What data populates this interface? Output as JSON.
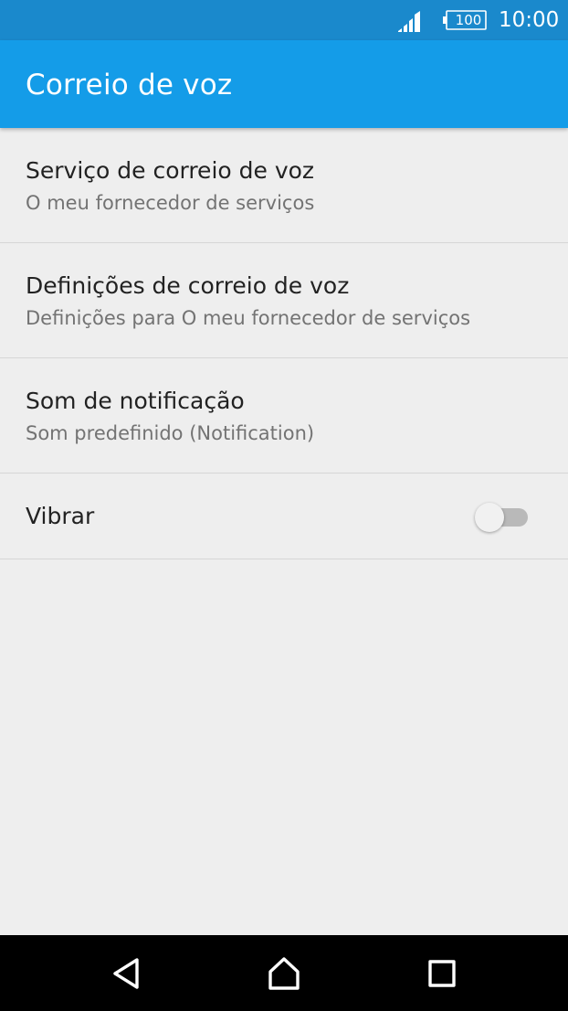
{
  "status_bar": {
    "battery_level": "100",
    "time": "10:00",
    "icons": [
      "signal-icon",
      "battery-icon"
    ]
  },
  "app_bar": {
    "title": "Correio de voz",
    "color": "#149ce8"
  },
  "preferences": [
    {
      "title": "Serviço de correio de voz",
      "summary": "O meu fornecedor de serviços"
    },
    {
      "title": "Definições de correio de voz",
      "summary": "Definições para O meu fornecedor de serviços"
    },
    {
      "title": "Som de notificação",
      "summary": "Som predefinido (Notification)"
    },
    {
      "title": "Vibrar",
      "toggle_on": false
    }
  ],
  "nav_bar": {
    "buttons": [
      "back-icon",
      "home-icon",
      "recents-icon"
    ]
  }
}
